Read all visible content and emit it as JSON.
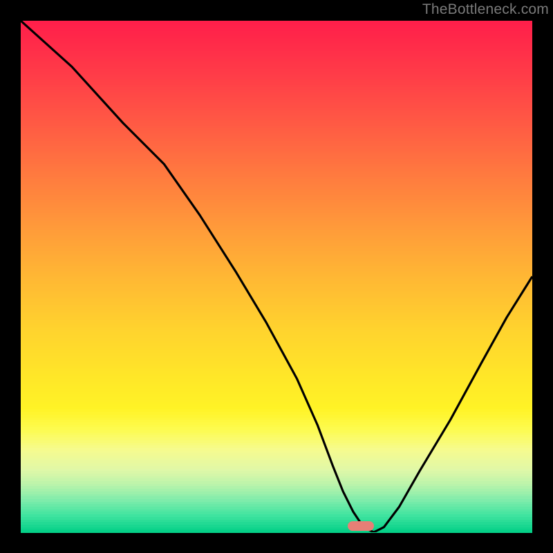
{
  "watermark": "TheBottleneck.com",
  "marker": {
    "x_percent": 66.5,
    "y_percent": 98.8
  },
  "chart_data": {
    "type": "line",
    "title": "",
    "xlabel": "",
    "ylabel": "",
    "xlim": [
      0,
      100
    ],
    "ylim": [
      0,
      100
    ],
    "series": [
      {
        "name": "bottleneck-curve",
        "x": [
          0,
          10,
          20,
          28,
          35,
          42,
          48,
          54,
          58,
          61,
          63,
          65,
          67,
          69,
          71,
          74,
          78,
          84,
          90,
          95,
          100
        ],
        "y": [
          100,
          91,
          80,
          72,
          62,
          51,
          41,
          30,
          21,
          13,
          8,
          4,
          1,
          0,
          1,
          5,
          12,
          22,
          33,
          42,
          50
        ]
      }
    ],
    "annotations": [],
    "legend": []
  },
  "gradient_stops": [
    {
      "pct": 0,
      "color": "#ff1f4a"
    },
    {
      "pct": 10,
      "color": "#ff3b48"
    },
    {
      "pct": 20,
      "color": "#ff5a44"
    },
    {
      "pct": 30,
      "color": "#ff7a3f"
    },
    {
      "pct": 40,
      "color": "#ff993a"
    },
    {
      "pct": 50,
      "color": "#ffb734"
    },
    {
      "pct": 60,
      "color": "#ffd22e"
    },
    {
      "pct": 70,
      "color": "#ffe728"
    },
    {
      "pct": 76,
      "color": "#fff326"
    },
    {
      "pct": 80,
      "color": "#fdfb4f"
    },
    {
      "pct": 84,
      "color": "#f6fb8e"
    },
    {
      "pct": 88,
      "color": "#e0f8a8"
    },
    {
      "pct": 91,
      "color": "#b9f3ab"
    },
    {
      "pct": 94,
      "color": "#7eecab"
    },
    {
      "pct": 97,
      "color": "#3fe39f"
    },
    {
      "pct": 100,
      "color": "#06d188"
    }
  ]
}
